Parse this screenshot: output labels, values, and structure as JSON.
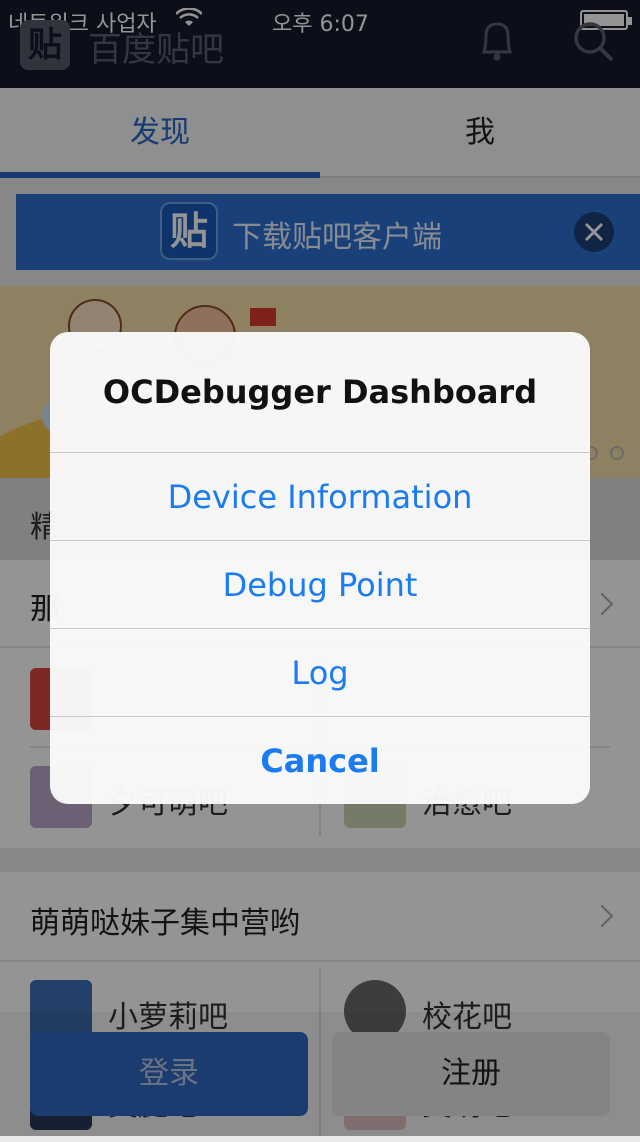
{
  "status_bar": {
    "carrier": "네트워크 사업자",
    "time": "오후 6:07"
  },
  "header": {
    "app_title": "百度贴吧",
    "logo_char": "贴"
  },
  "tabs": [
    {
      "label": "发现"
    },
    {
      "label": "我"
    }
  ],
  "download_banner": {
    "label": "下载贴吧客户端",
    "logo_char": "贴"
  },
  "sections": {
    "featured_title": "精",
    "card1": {
      "title": "那",
      "items": [
        {
          "name": "夕可萌吧"
        },
        {
          "name": "治愈吧"
        }
      ]
    },
    "card2": {
      "title": "萌萌哒妹子集中营哟",
      "items": [
        {
          "name": "小萝莉吧"
        },
        {
          "name": "校花吧"
        },
        {
          "name": "美腿吧"
        },
        {
          "name": "美萌吧"
        }
      ]
    }
  },
  "bottom_buttons": {
    "login": "登录",
    "register": "注册"
  },
  "alert": {
    "title": "OCDebugger Dashboard",
    "actions": [
      {
        "label": "Device Information"
      },
      {
        "label": "Debug Point"
      },
      {
        "label": "Log"
      },
      {
        "label": "Cancel"
      }
    ]
  },
  "colors": {
    "accent": "#2867c5",
    "nav_bg": "#16192b",
    "alert_action": "#1a7cf0"
  }
}
